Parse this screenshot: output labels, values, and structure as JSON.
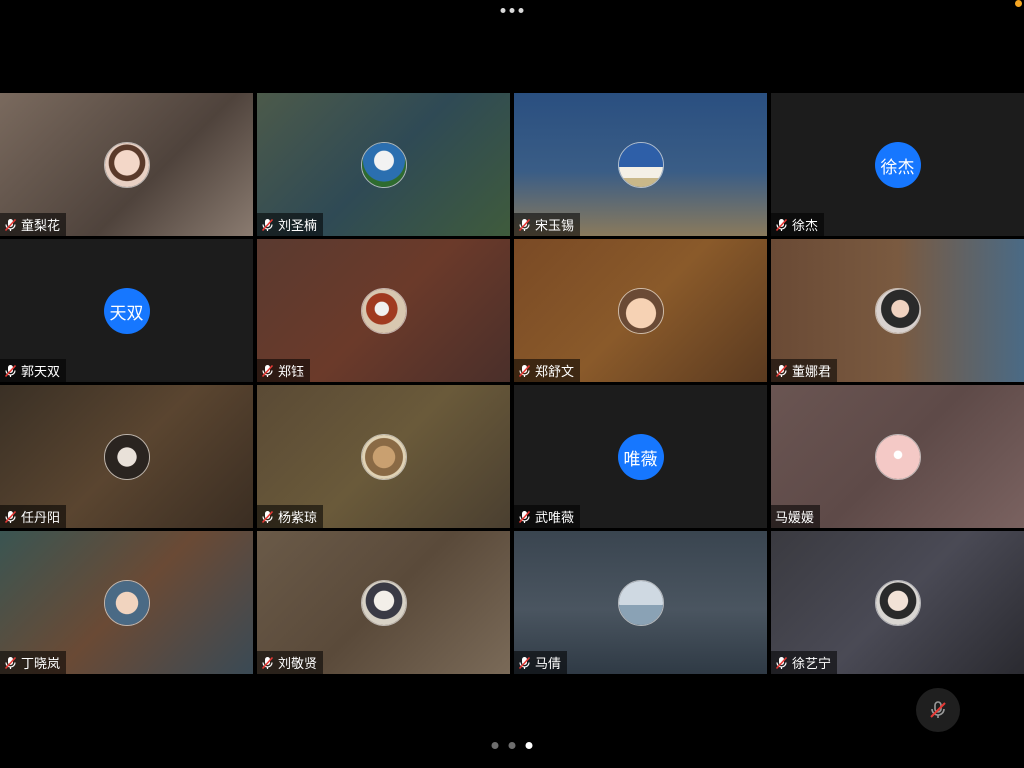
{
  "colors": {
    "background": "#000000",
    "accent_avatar": "#1677ff",
    "status_dot": "#f5a623"
  },
  "top_menu": {
    "icon": "more-horizontal-icon"
  },
  "participants": [
    {
      "name": "童梨花",
      "avatar_type": "photo",
      "bg": "linear-gradient(135deg,#7a6a5e,#4f433c 60%,#8a7b70)",
      "pic": "radial-gradient(circle at 50% 45%,#f3d7c8 0 38%,#5a3a2a 40% 55%,#e9d1c4 57%)",
      "muted": true
    },
    {
      "name": "刘圣楠",
      "avatar_type": "photo",
      "bg": "linear-gradient(135deg,#4c5a4a,#2f4a55 50%,#3f5b3c)",
      "pic": "radial-gradient(circle at 50% 40%,#f2f2f2 0 28%,#2b6fb0 30% 60%,#2e6b2f 62%)",
      "muted": true
    },
    {
      "name": "宋玉锡",
      "avatar_type": "photo",
      "bg": "linear-gradient(180deg,#2a4f80,#3a5d86 55%,#8a7a5c)",
      "pic": "linear-gradient(180deg,#2e5fa8 0 55%,#f4f0e6 55% 80%,#c9b889 80%)",
      "muted": true
    },
    {
      "name": "徐杰",
      "avatar_type": "text",
      "avatar_text": "徐杰",
      "bg": "#1c1c1c",
      "muted": true
    },
    {
      "name": "郭天双",
      "avatar_type": "text",
      "avatar_text": "天双",
      "bg": "#1c1c1c",
      "muted": true
    },
    {
      "name": "郑钰",
      "avatar_type": "photo",
      "bg": "linear-gradient(135deg,#5a3a30,#6b3a2a 50%,#4a2f2a)",
      "pic": "radial-gradient(circle at 45% 45%,#f1f1f1 0 20%,#a03a20 22% 45%,#d8c7b0 47%)",
      "muted": true
    },
    {
      "name": "郑舒文",
      "avatar_type": "photo",
      "bg": "linear-gradient(135deg,#7a4a25,#8a5a2a 50%,#5a3a20)",
      "pic": "radial-gradient(circle at 50% 55%,#f6d2b4 0 45%,#6a4a35 47%)",
      "muted": true
    },
    {
      "name": "董娜君",
      "avatar_type": "photo",
      "bg": "linear-gradient(90deg,#6a4a35,#7a5a40 50%,#4a6a85)",
      "pic": "radial-gradient(circle at 55% 45%,#f0d2c0 0 25%,#2a2a2a 27% 55%,#d9d2cf 57%)",
      "muted": true
    },
    {
      "name": "任丹阳",
      "avatar_type": "photo",
      "bg": "linear-gradient(135deg,#3a3025,#5a4530 50%,#3a2d22)",
      "pic": "radial-gradient(circle at 50% 50%,#e9e1d9 0 30%,#2a2420 32%)",
      "muted": true
    },
    {
      "name": "杨紫琼",
      "avatar_type": "photo",
      "bg": "linear-gradient(135deg,#5a4a35,#6a5a3a 50%,#4a3f30)",
      "pic": "radial-gradient(circle at 50% 50%,#c9a070 0 35%,#8a6a45 37% 60%,#e0d2b4 62%)",
      "muted": true
    },
    {
      "name": "武唯薇",
      "avatar_type": "text",
      "avatar_text": "唯薇",
      "bg": "#1c1c1c",
      "muted": true
    },
    {
      "name": "马媛媛",
      "avatar_type": "photo",
      "bg": "linear-gradient(135deg,#6a5552,#5e4a48 50%,#7a6260)",
      "pic": "radial-gradient(circle at 50% 45%,#ffffff 0 12%,#f4c9c6 14%)",
      "muted": false
    },
    {
      "name": "丁晓岚",
      "avatar_type": "photo",
      "bg": "linear-gradient(135deg,#3a5552,#6a4a35 50%,#3a4a55)",
      "pic": "radial-gradient(circle at 50% 50%,#f1d4bf 0 35%,#4a6a85 37%)",
      "muted": true
    },
    {
      "name": "刘敬贤",
      "avatar_type": "photo",
      "bg": "linear-gradient(135deg,#6a5a48,#5a4a3a 50%,#7a6a58)",
      "pic": "radial-gradient(circle at 50% 45%,#f3efe9 0 30%,#3a3a45 32% 55%,#d8d2c6 57%)",
      "muted": true
    },
    {
      "name": "马倩",
      "avatar_type": "photo",
      "bg": "linear-gradient(180deg,#3a4550,#4a5560 55%,#2f3a45)",
      "pic": "linear-gradient(180deg,#cfd9e2 0 55%,#8aa2b5 55%)",
      "muted": true
    },
    {
      "name": "徐艺宁",
      "avatar_type": "photo",
      "bg": "linear-gradient(135deg,#3a3a40,#4a4a55 50%,#2a2a30)",
      "pic": "radial-gradient(circle at 50% 45%,#f2e2d6 0 30%,#2a2a2a 32% 55%,#d9d6d2 57%)",
      "muted": true
    }
  ],
  "pager": {
    "pages": 3,
    "current": 3
  },
  "controls": {
    "mute_icon": "mic-off-icon"
  }
}
